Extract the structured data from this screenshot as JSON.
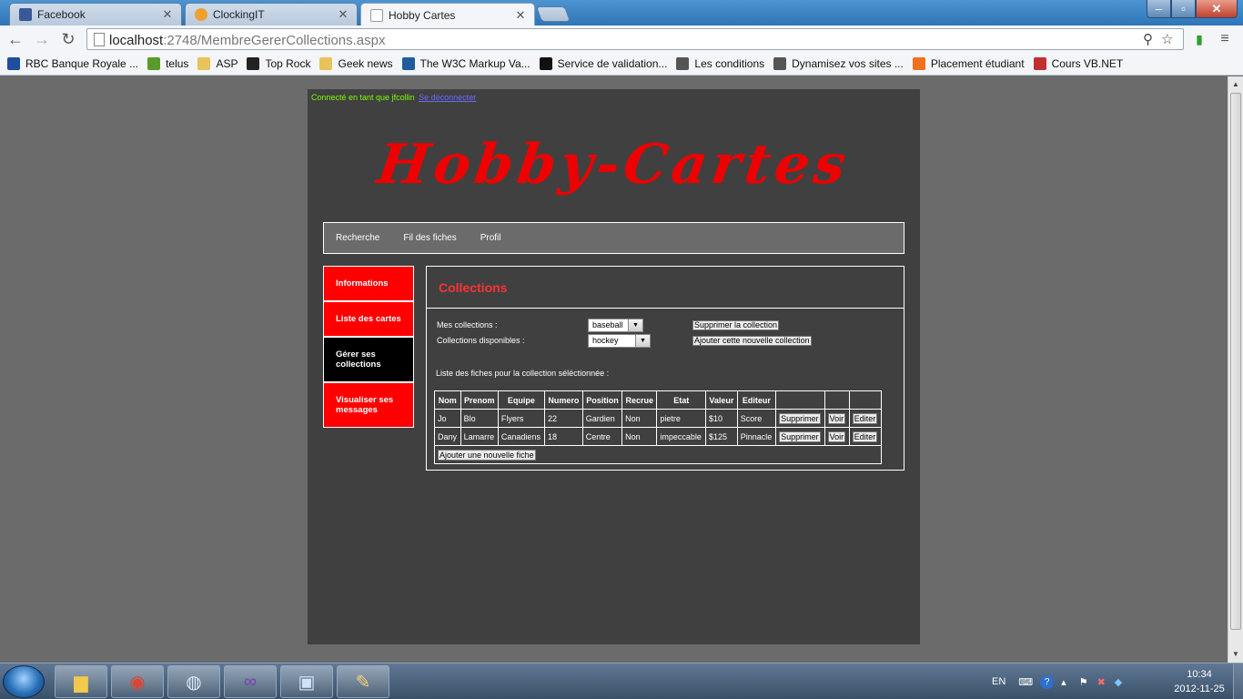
{
  "browser": {
    "tabs": [
      {
        "label": "Facebook",
        "color": "#3b5998",
        "active": false
      },
      {
        "label": "ClockingIT",
        "color": "#f0a030",
        "active": false
      },
      {
        "label": "Hobby Cartes",
        "color": "#ffffff",
        "active": true
      }
    ],
    "url_host": "localhost",
    "url_path": ":2748/MembreGererCollections.aspx",
    "bookmarks": [
      {
        "label": "RBC Banque Royale ...",
        "color": "#1f4e9c"
      },
      {
        "label": "telus",
        "color": "#5a9a2a"
      },
      {
        "label": "ASP",
        "color": "#e8c35a"
      },
      {
        "label": "Top Rock",
        "color": "#222222"
      },
      {
        "label": "Geek news",
        "color": "#e8c35a"
      },
      {
        "label": "The W3C Markup Va...",
        "color": "#1f5d9c"
      },
      {
        "label": "Service de validation...",
        "color": "#111111"
      },
      {
        "label": "Les conditions",
        "color": "#555555"
      },
      {
        "label": "Dynamisez vos sites ...",
        "color": "#555555"
      },
      {
        "label": "Placement étudiant",
        "color": "#f07020"
      },
      {
        "label": "Cours VB.NET",
        "color": "#c03030"
      }
    ]
  },
  "site": {
    "login_text": "Connecté en tant que jfcollin",
    "logout_label": "Se déconnecter",
    "logo": "Hobby-Cartes",
    "menu": [
      "Recherche",
      "Fil des fiches",
      "Profil"
    ],
    "sidebar": [
      {
        "label": "Informations",
        "active": false
      },
      {
        "label": "Liste des cartes",
        "active": false
      },
      {
        "label": "Gérer ses collections",
        "active": true
      },
      {
        "label": "Visualiser ses messages",
        "active": false
      }
    ],
    "content_title": "Collections",
    "mes_collections_label": "Mes collections :",
    "mes_collections_value": "baseball",
    "supprimer_collection_label": "Supprimer la collection",
    "collections_disponibles_label": "Collections disponibles :",
    "collections_disponibles_value": "hockey",
    "ajouter_collection_label": "Ajouter cette nouvelle collection",
    "liste_fiches_label": "Liste des fiches pour la collection séléctionnée :",
    "table_headers": [
      "Nom",
      "Prenom",
      "Equipe",
      "Numero",
      "Position",
      "Recrue",
      "Etat",
      "Valeur",
      "Editeur"
    ],
    "rows": [
      {
        "nom": "Jo",
        "prenom": "Blo",
        "equipe": "Flyers",
        "numero": "22",
        "position": "Gardien",
        "recrue": "Non",
        "etat": "pietre",
        "valeur": "$10",
        "editeur": "Score"
      },
      {
        "nom": "Dany",
        "prenom": "Lamarre",
        "equipe": "Canadiens",
        "numero": "18",
        "position": "Centre",
        "recrue": "Non",
        "etat": "impeccable",
        "valeur": "$125",
        "editeur": "Pinnacle"
      }
    ],
    "row_actions": {
      "delete": "Supprimer",
      "view": "Voir",
      "edit": "Editer"
    },
    "add_fiche_label": "Ajouter une nouvelle fiche"
  },
  "taskbar": {
    "lang": "EN",
    "time": "10:34",
    "date": "2012-11-25"
  }
}
